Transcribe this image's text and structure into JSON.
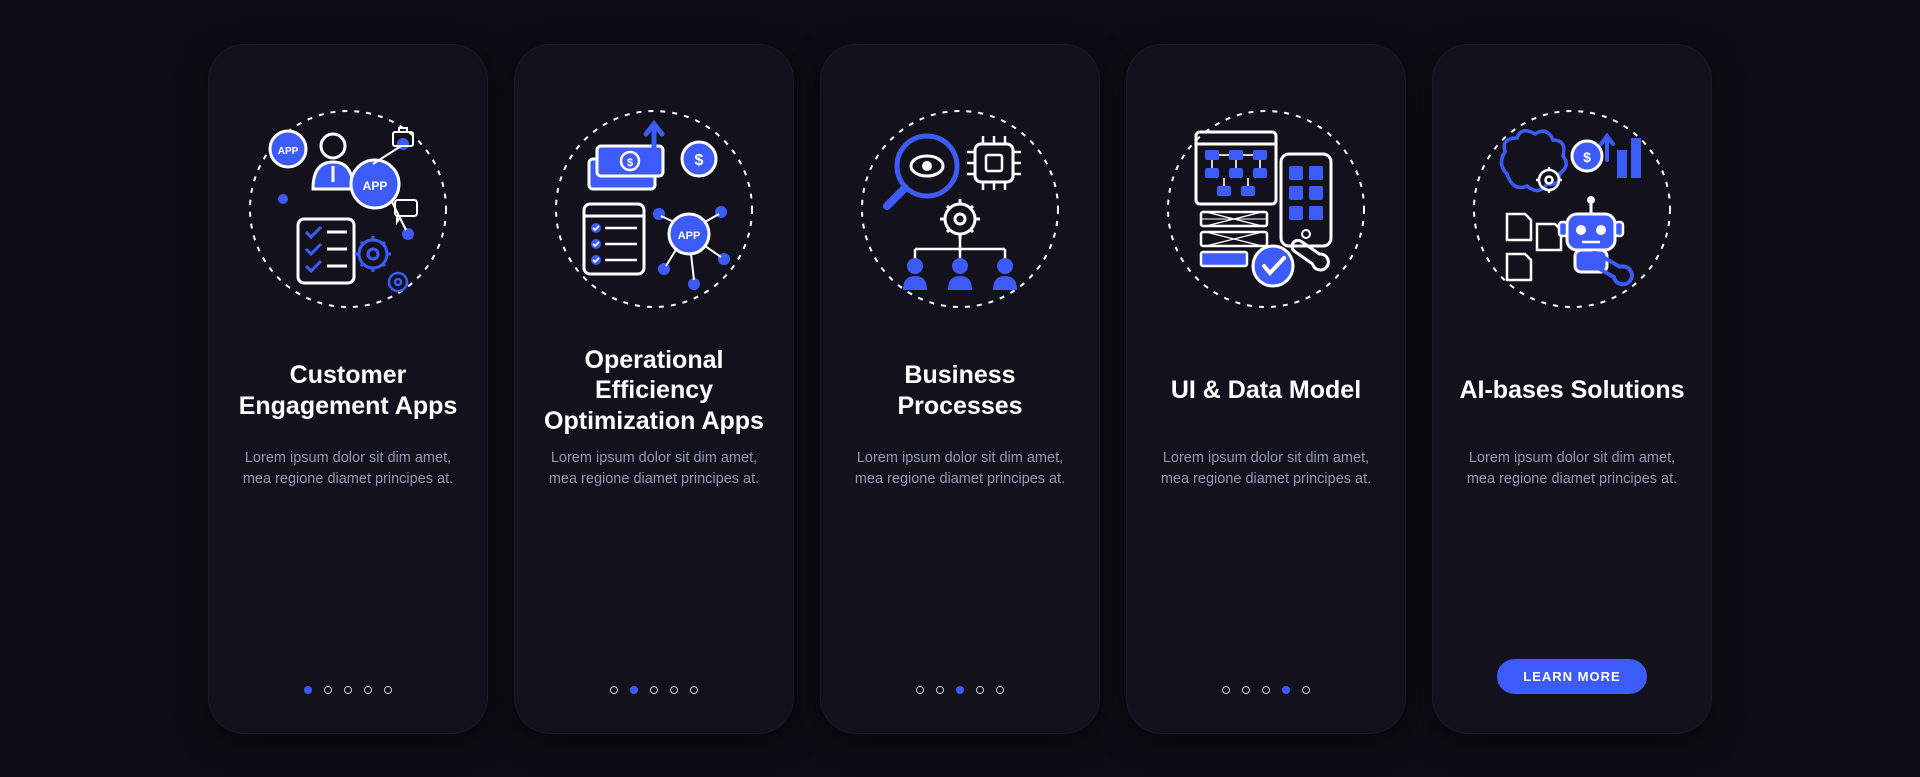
{
  "colors": {
    "accent": "#3d5bf9",
    "card_bg": "#13121c",
    "page_bg": "#0e0d15",
    "muted_text": "#8f97b3"
  },
  "pager_total": 5,
  "common_description": "Lorem ipsum dolor sit dim amet, mea regione diamet principes at.",
  "learn_more_label": "LEARN MORE",
  "cards": [
    {
      "id": "customer-engagement",
      "title": "Customer Engagement Apps",
      "icon_name": "customer-engagement-icon",
      "active_dot": 0,
      "has_button": false
    },
    {
      "id": "operational-efficiency",
      "title": "Operational Efficiency Optimization Apps",
      "icon_name": "operational-efficiency-icon",
      "active_dot": 1,
      "has_button": false
    },
    {
      "id": "business-processes",
      "title": "Business Processes",
      "icon_name": "business-processes-icon",
      "active_dot": 2,
      "has_button": false
    },
    {
      "id": "ui-data-model",
      "title": "UI & Data Model",
      "icon_name": "ui-data-model-icon",
      "active_dot": 3,
      "has_button": false
    },
    {
      "id": "ai-solutions",
      "title": "AI-bases Solutions",
      "icon_name": "ai-solutions-icon",
      "active_dot": null,
      "has_button": true
    }
  ]
}
